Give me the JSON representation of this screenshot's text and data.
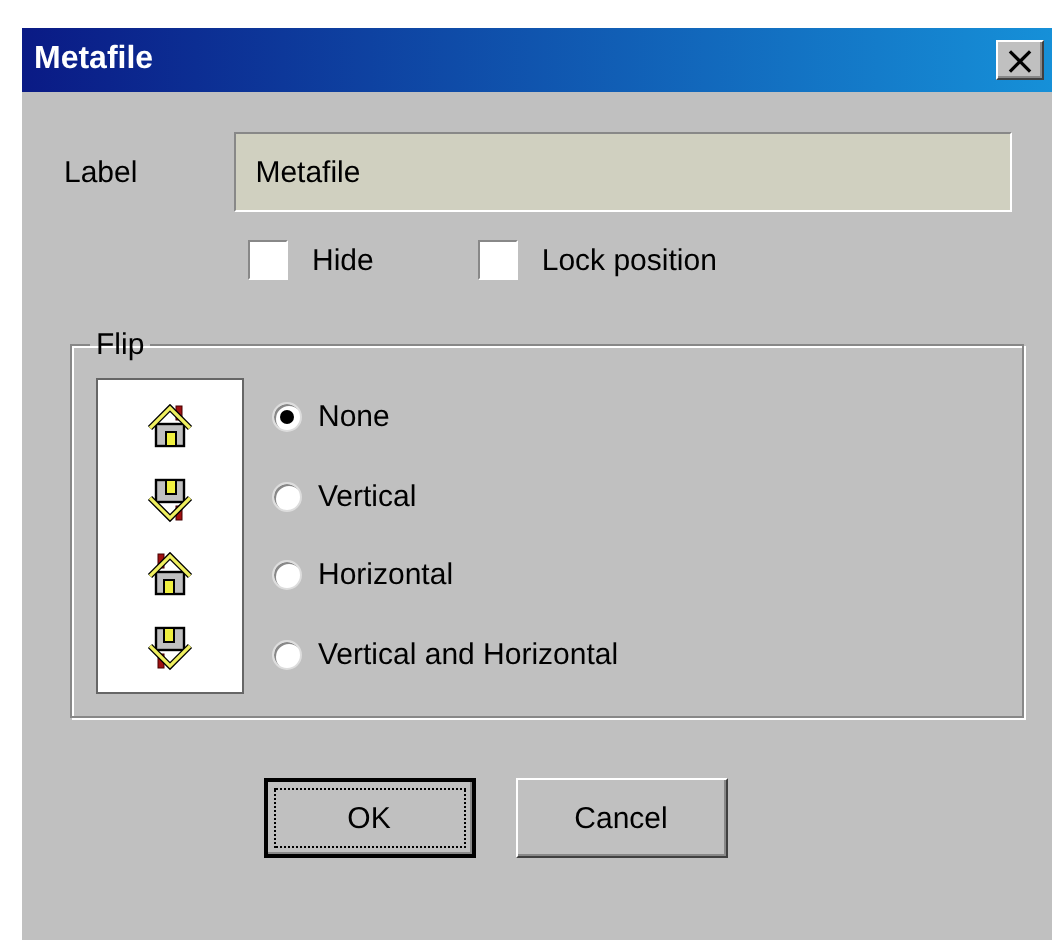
{
  "window": {
    "title": "Metafile",
    "close": "×"
  },
  "label": {
    "caption": "Label",
    "value": "Metafile"
  },
  "checkboxes": [
    {
      "label": "Hide",
      "checked": false
    },
    {
      "label": "Lock position",
      "checked": false
    }
  ],
  "flip": {
    "title": "Flip",
    "options": [
      {
        "label": "None",
        "kind": "none",
        "selected": true
      },
      {
        "label": "Vertical",
        "kind": "vertical",
        "selected": false
      },
      {
        "label": "Horizontal",
        "kind": "horizontal",
        "selected": false
      },
      {
        "label": "Vertical and Horizontal",
        "kind": "both",
        "selected": false
      }
    ]
  },
  "buttons": [
    {
      "label": "OK",
      "default": true
    },
    {
      "label": "Cancel",
      "default": false
    }
  ]
}
